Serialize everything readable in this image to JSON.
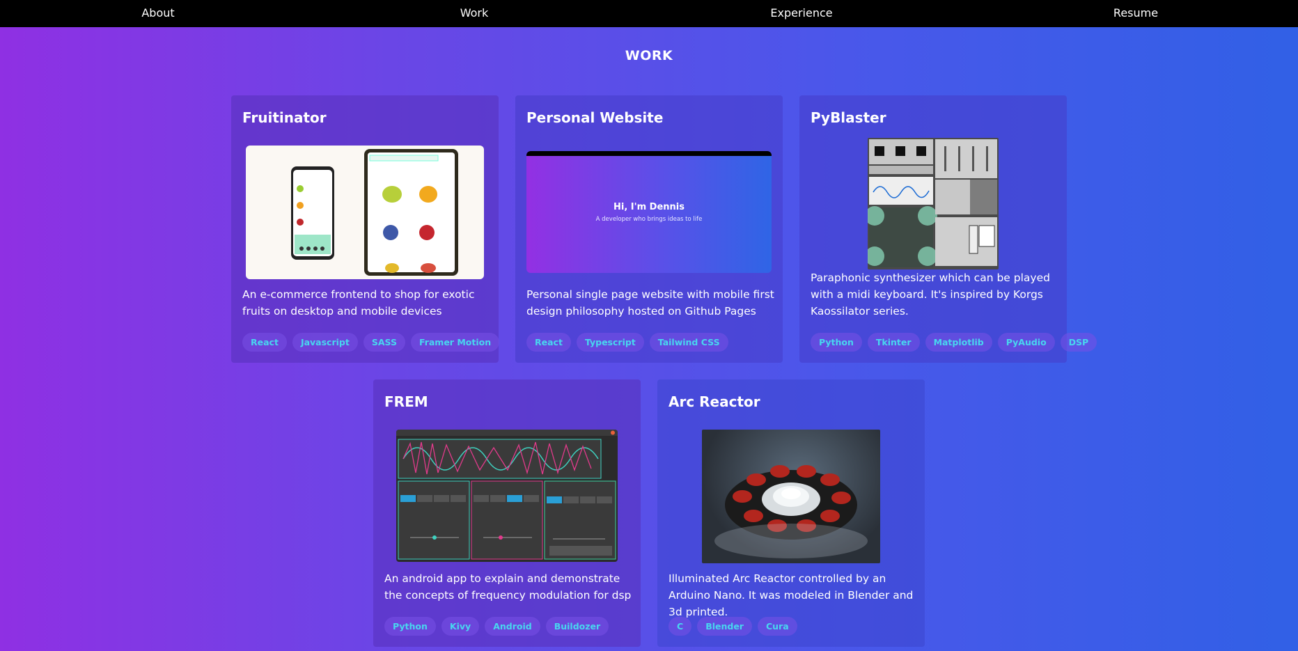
{
  "nav": {
    "items": [
      "About",
      "Work",
      "Experience",
      "Resume"
    ]
  },
  "section": {
    "title": "WORK"
  },
  "projects": [
    {
      "title": "Fruitinator",
      "description": "An e-commerce frontend to shop for exotic fruits on desktop and mobile devices",
      "tags": [
        "React",
        "Javascript",
        "SASS",
        "Framer Motion"
      ]
    },
    {
      "title": "Personal Website",
      "description": "Personal single page website with mobile first design philosophy hosted on Github Pages",
      "tags": [
        "React",
        "Typescript",
        "Tailwind CSS"
      ],
      "preview": {
        "heading": "Hi, I'm Dennis",
        "subheading": "A developer who brings ideas to life"
      }
    },
    {
      "title": "PyBlaster",
      "description": "Paraphonic synthesizer which can be played with a midi keyboard. It's inspired by Korgs Kaossilator series.",
      "tags": [
        "Python",
        "Tkinter",
        "Matplotlib",
        "PyAudio",
        "DSP"
      ]
    },
    {
      "title": "FREM",
      "description": "An android app to explain and demonstrate the concepts of frequency modulation for dsp",
      "tags": [
        "Python",
        "Kivy",
        "Android",
        "Buildozer"
      ]
    },
    {
      "title": "Arc Reactor",
      "description": "Illuminated Arc Reactor controlled by an Arduino Nano. It was modeled in Blender and 3d printed.",
      "tags": [
        "C",
        "Blender",
        "Cura"
      ]
    }
  ]
}
